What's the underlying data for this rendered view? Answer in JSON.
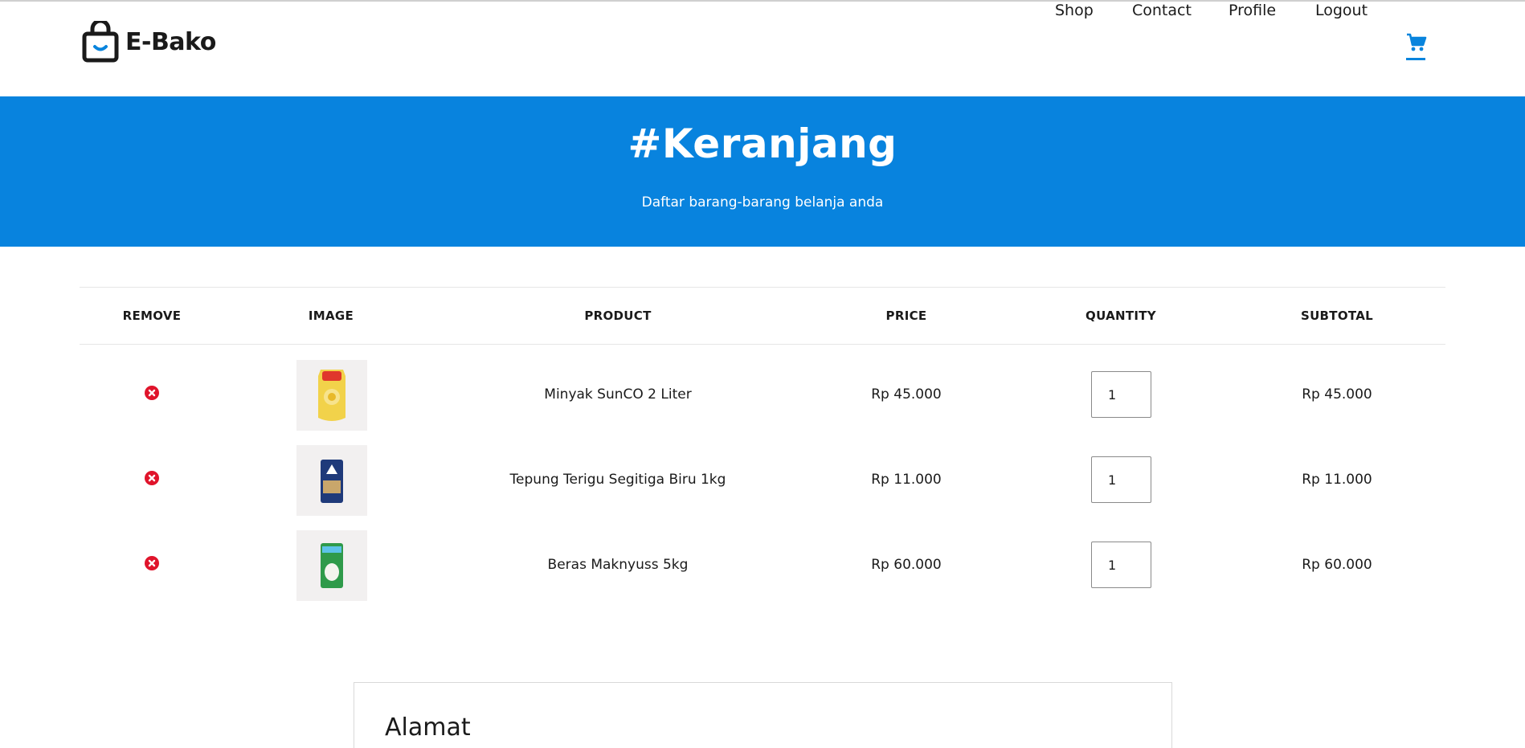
{
  "brand": {
    "name": "E-Bako",
    "accent_color": "#0883de",
    "icon": "shopping-bag-icon"
  },
  "nav": {
    "shop": "Shop",
    "contact": "Contact",
    "profile": "Profile",
    "logout": "Logout",
    "cart_icon": "cart-icon"
  },
  "banner": {
    "title": "#Keranjang",
    "subtitle": "Daftar barang-barang belanja anda"
  },
  "table": {
    "headers": {
      "remove": "REMOVE",
      "image": "IMAGE",
      "product": "PRODUCT",
      "price": "PRICE",
      "quantity": "QUANTITY",
      "subtotal": "SUBTOTAL"
    },
    "rows": [
      {
        "product": "Minyak SunCO 2 Liter",
        "price": "Rp 45.000",
        "quantity": "1",
        "subtotal": "Rp 45.000",
        "remove_icon": "remove-x-icon"
      },
      {
        "product": "Tepung Terigu Segitiga Biru 1kg",
        "price": "Rp 11.000",
        "quantity": "1",
        "subtotal": "Rp 11.000",
        "remove_icon": "remove-x-icon"
      },
      {
        "product": "Beras Maknyuss 5kg",
        "price": "Rp 60.000",
        "quantity": "1",
        "subtotal": "Rp 60.000",
        "remove_icon": "remove-x-icon"
      }
    ]
  },
  "address": {
    "title": "Alamat"
  }
}
